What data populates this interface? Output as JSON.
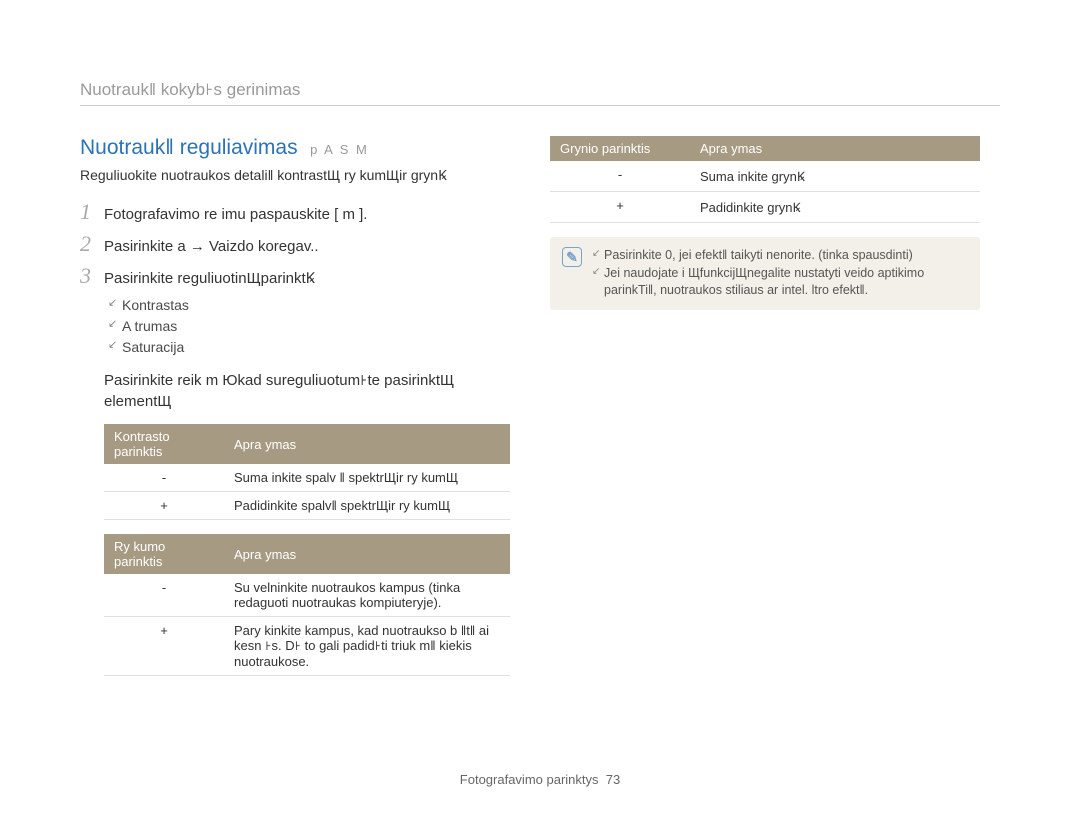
{
  "page_title": "Nuotraukǁ kokyb꜔s gerinimas",
  "section": {
    "title": "Nuotraukǁ reguliavimas",
    "modes": "p A S M",
    "desc": "Reguliuokite nuotraukos detaliǁ kontrastЩ ry kumЩir grynꝂ"
  },
  "steps": [
    {
      "num": "1",
      "text": "Fotografavimo re imu paspauskite [ m       ]."
    },
    {
      "num": "2",
      "text": "Pasirinkite a     → Vaizdo koregav.."
    },
    {
      "num": "3",
      "text": "Pasirinkite reguliuotinЩparinktꝂ"
    }
  ],
  "bullets": [
    "Kontrastas",
    "A trumas",
    "Saturacija"
  ],
  "paragraph": "Pasirinkite reik m Юkad sureguliuotum꜔te pasirinktЩ elementЩ",
  "table_contrast": {
    "h1": "Kontrasto parinktis",
    "h2": "Apra ymas",
    "rows": [
      {
        "c1": "-",
        "c2": "Suma inkite spalv ǁ spektrЩir ry kumЩ"
      },
      {
        "c1": "+",
        "c2": "Padidinkite spalvǁ spektrЩir ry kumЩ"
      }
    ]
  },
  "table_sharpness": {
    "h1": "Ry kumo parinktis",
    "h2": "Apra ymas",
    "rows": [
      {
        "c1": "-",
        "c2": "Su velninkite  nuotraukos kampus (tinka redaguoti nuotraukas kompiuteryje)."
      },
      {
        "c1": "+",
        "c2": "Pary kinkite kampus, kad nuotraukso b ǁtǁ ai kesn ꜔s. D꜔ to gali padid꜔ti triuk mǁ kiekis nuotraukose."
      }
    ]
  },
  "table_saturation": {
    "h1": "Grynio parinktis",
    "h2": "Apra ymas",
    "rows": [
      {
        "c1": "-",
        "c2": "Suma inkite grynꝂ"
      },
      {
        "c1": "+",
        "c2": "Padidinkite grynꝂ"
      }
    ]
  },
  "notes": [
    "Pasirinkite 0, jei efektǁ taikyti nenorite. (tinka spausdinti)",
    "Jei naudojate  i ЩfunkcijЩnegalite nustatyti veido aptikimo parinkTiǁ, nuotraukos stiliaus ar intel. ltro efektǁ."
  ],
  "footer": {
    "label": "Fotografavimo parinktys",
    "page": "73"
  }
}
